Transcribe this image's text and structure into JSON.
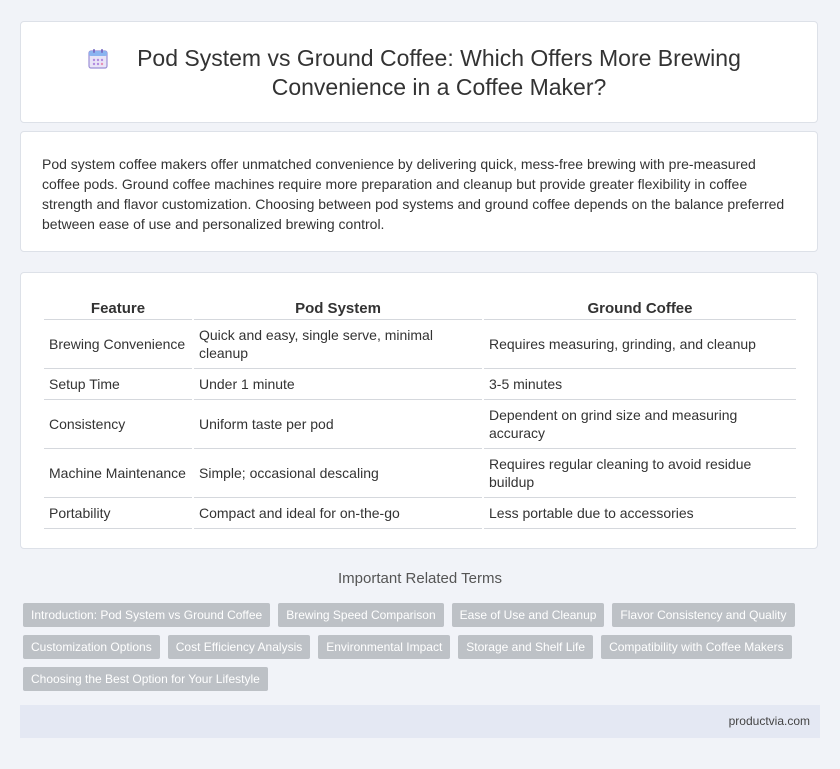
{
  "header": {
    "title": "Pod System vs Ground Coffee: Which Offers More Brewing Convenience in a Coffee Maker?",
    "icon": "calendar-icon"
  },
  "intro": {
    "text": "Pod system coffee makers offer unmatched convenience by delivering quick, mess-free brewing with pre-measured coffee pods. Ground coffee machines require more preparation and cleanup but provide greater flexibility in coffee strength and flavor customization. Choosing between pod systems and ground coffee depends on the balance preferred between ease of use and personalized brewing control."
  },
  "table": {
    "headers": [
      "Feature",
      "Pod System",
      "Ground Coffee"
    ],
    "rows": [
      [
        "Brewing Convenience",
        "Quick and easy, single serve, minimal cleanup",
        "Requires measuring, grinding, and cleanup"
      ],
      [
        "Setup Time",
        "Under 1 minute",
        "3-5 minutes"
      ],
      [
        "Consistency",
        "Uniform taste per pod",
        "Dependent on grind size and measuring accuracy"
      ],
      [
        "Machine Maintenance",
        "Simple; occasional descaling",
        "Requires regular cleaning to avoid residue buildup"
      ],
      [
        "Portability",
        "Compact and ideal for on-the-go",
        "Less portable due to accessories"
      ]
    ]
  },
  "related": {
    "title": "Important Related Terms",
    "tags": [
      "Introduction: Pod System vs Ground Coffee",
      "Brewing Speed Comparison",
      "Ease of Use and Cleanup",
      "Flavor Consistency and Quality",
      "Customization Options",
      "Cost Efficiency Analysis",
      "Environmental Impact",
      "Storage and Shelf Life",
      "Compatibility with Coffee Makers",
      "Choosing the Best Option for Your Lifestyle"
    ]
  },
  "footer": {
    "site": "productvia.com"
  }
}
